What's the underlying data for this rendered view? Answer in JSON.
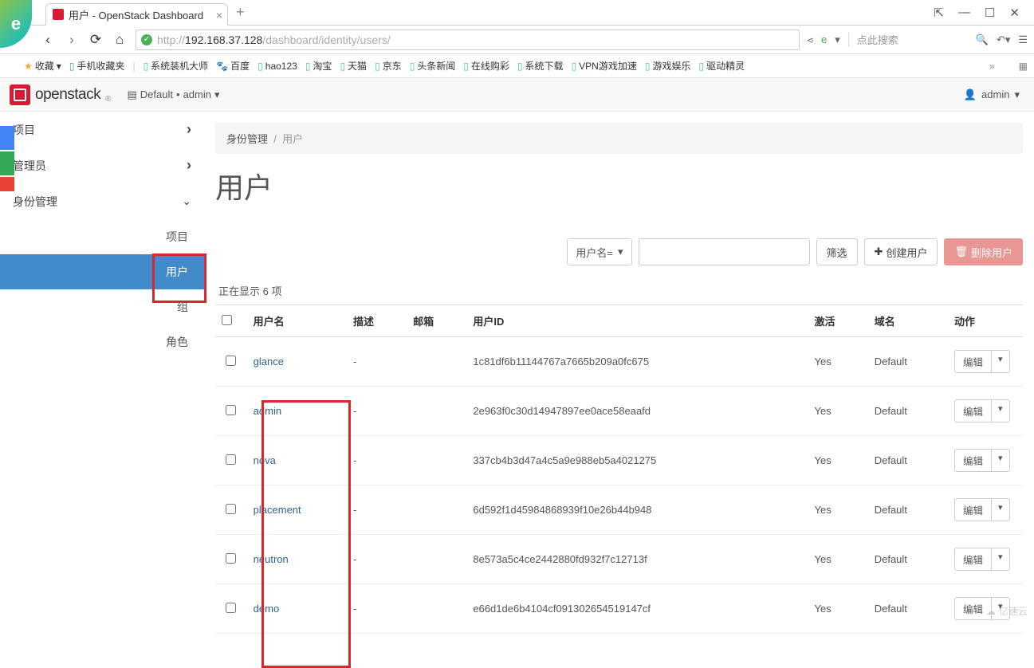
{
  "browser": {
    "tab_title": "用户 - OpenStack Dashboard",
    "url_prefix": "http://",
    "url_host": "192.168.37.128",
    "url_path": "/dashboard/identity/users/",
    "search_placeholder": "点此搜索"
  },
  "bookmarks": {
    "fav_label": "收藏",
    "mobile_label": "手机收藏夹",
    "items": [
      "系统装机大师",
      "百度",
      "hao123",
      "淘宝",
      "天猫",
      "京东",
      "头条新闻",
      "在线购彩",
      "系统下载",
      "VPN游戏加速",
      "游戏娱乐",
      "驱动精灵"
    ]
  },
  "header": {
    "brand": "openstack",
    "domain_label": "Default",
    "dot": "•",
    "project_label": "admin",
    "user_label": "admin"
  },
  "sidebar": {
    "groups": [
      {
        "label": "项目",
        "chev": "›"
      },
      {
        "label": "管理员",
        "chev": "›"
      },
      {
        "label": "身份管理",
        "chev": "⌄"
      }
    ],
    "subs": [
      {
        "label": "项目"
      },
      {
        "label": "用户"
      },
      {
        "label": "组"
      },
      {
        "label": "角色"
      }
    ]
  },
  "breadcrumb": {
    "a": "身份管理",
    "sep": "/",
    "b": "用户"
  },
  "page_title": "用户",
  "toolbar": {
    "filter_field": "用户名=",
    "filter_btn": "筛选",
    "create_btn": "创建用户",
    "delete_btn": "删除用户"
  },
  "count_text": "正在显示 6 项",
  "columns": {
    "name": "用户名",
    "desc": "描述",
    "email": "邮箱",
    "id": "用户ID",
    "active": "激活",
    "domain": "域名",
    "action": "动作"
  },
  "action_label": "编辑",
  "rows": [
    {
      "name": "glance",
      "desc": "-",
      "email": "",
      "id": "1c81df6b11144767a7665b209a0fc675",
      "active": "Yes",
      "domain": "Default"
    },
    {
      "name": "admin",
      "desc": "-",
      "email": "",
      "id": "2e963f0c30d14947897ee0ace58eaafd",
      "active": "Yes",
      "domain": "Default"
    },
    {
      "name": "nova",
      "desc": "-",
      "email": "",
      "id": "337cb4b3d47a4c5a9e988eb5a4021275",
      "active": "Yes",
      "domain": "Default"
    },
    {
      "name": "placement",
      "desc": "-",
      "email": "",
      "id": "6d592f1d45984868939f10e26b44b948",
      "active": "Yes",
      "domain": "Default"
    },
    {
      "name": "neutron",
      "desc": "-",
      "email": "",
      "id": "8e573a5c4ce2442880fd932f7c12713f",
      "active": "Yes",
      "domain": "Default"
    },
    {
      "name": "demo",
      "desc": "-",
      "email": "",
      "id": "e66d1de6b4104cf091302654519147cf",
      "active": "Yes",
      "domain": "Default"
    }
  ],
  "watermark": "亿速云"
}
